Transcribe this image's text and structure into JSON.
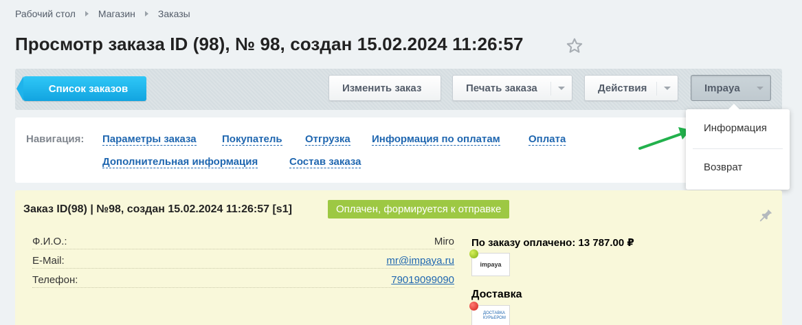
{
  "breadcrumb": {
    "items": [
      "Рабочий стол",
      "Магазин",
      "Заказы"
    ]
  },
  "page": {
    "title": "Просмотр заказа ID (98), № 98, создан 15.02.2024 11:26:57"
  },
  "toolbar": {
    "list_label": "Список заказов",
    "edit_label": "Изменить заказ",
    "print_label": "Печать заказа",
    "actions_label": "Действия",
    "impaya_label": "Impaya"
  },
  "dropdown": {
    "items": [
      "Информация",
      "Возврат"
    ]
  },
  "navigation": {
    "label": "Навигация:",
    "links": [
      "Параметры заказа",
      "Покупатель",
      "Отгрузка",
      "Информация по оплатам",
      "Оплата",
      "Дополнительная информация",
      "Состав заказа"
    ]
  },
  "order": {
    "header": "Заказ ID(98) | №98, создан 15.02.2024 11:26:57 [s1]",
    "status": "Оплачен, формируется к отправке",
    "fields": [
      {
        "label": "Ф.И.О.:",
        "value": "Miro"
      },
      {
        "label": "E-Mail:",
        "value": "mr@impaya.ru"
      },
      {
        "label": "Телефон:",
        "value": "79019099090"
      }
    ],
    "paid_text": "По заказу оплачено: 13 787.00 ₽",
    "payment_logo_text": "impaya",
    "delivery_title": "Доставка",
    "delivery_logo_text": "ДОСТАВКА КУРЬЕРОМ"
  },
  "colors": {
    "accent_blue": "#12a4e0",
    "status_green": "#9dc843",
    "link": "#2067b0",
    "order_bg": "#f9f8da"
  },
  "icons": [
    "star-icon",
    "pin-icon",
    "chevron-down-icon",
    "arrow-icon"
  ]
}
